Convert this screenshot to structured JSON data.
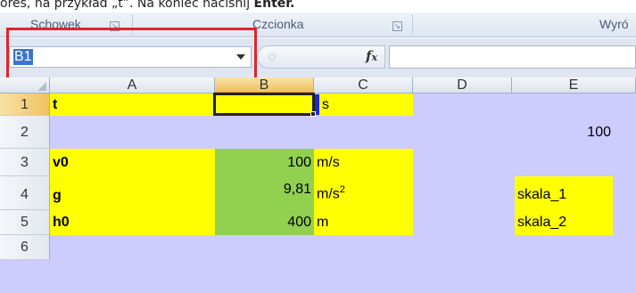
{
  "caption": {
    "text_before": "ores, na przykład „t”. Na koniec naciśnij ",
    "bold": "Enter."
  },
  "ribbon": {
    "groups": [
      "Schowek",
      "Czcionka",
      "Wyró"
    ]
  },
  "formula_bar": {
    "name_box": "B1",
    "fx_label": "fx",
    "formula": ""
  },
  "columns": [
    "A",
    "B",
    "C",
    "D",
    "E"
  ],
  "rows": [
    {
      "num": "1",
      "a": "t",
      "b": "",
      "c": "s",
      "e": ""
    },
    {
      "num": "2",
      "a": "",
      "b": "",
      "c": "",
      "e": "100"
    },
    {
      "num": "3",
      "a": "v0",
      "b": "100",
      "c": "m/s",
      "e": ""
    },
    {
      "num": "4",
      "a": "g",
      "b": "9,81",
      "c": "m/s",
      "c_sup": "2",
      "e": "skala_1"
    },
    {
      "num": "5",
      "a": "h0",
      "b": "400",
      "c": "m",
      "e": "skala_2"
    },
    {
      "num": "6",
      "a": "",
      "b": "",
      "c": "",
      "e": ""
    }
  ],
  "colors": {
    "sheet_bg": "#ccccff",
    "yellow": "#ffff00",
    "green": "#92d050",
    "highlight": "#e0242c"
  }
}
